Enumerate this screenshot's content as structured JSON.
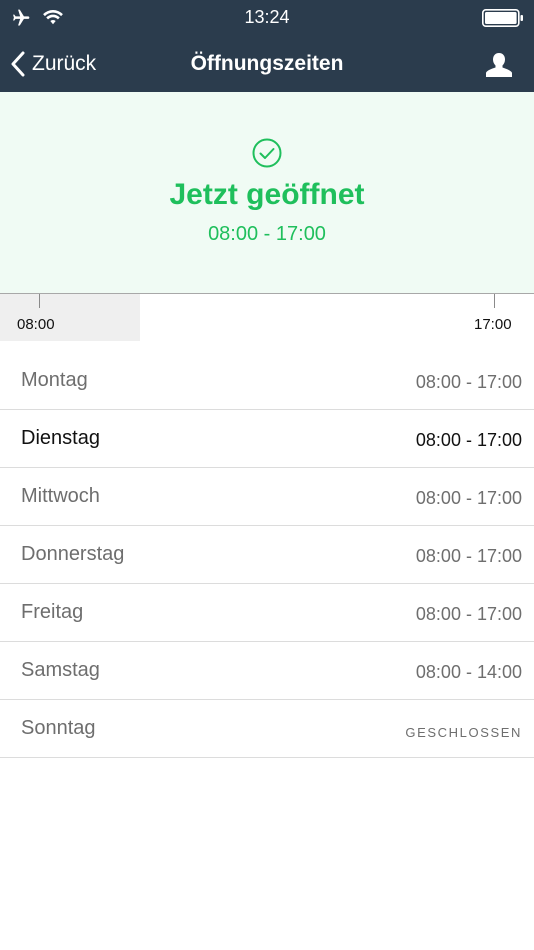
{
  "status_bar": {
    "time": "13:24"
  },
  "nav": {
    "back_label": "Zurück",
    "title": "Öffnungszeiten"
  },
  "banner": {
    "state": "Jetzt geöffnet",
    "hours": "08:00 - 17:00",
    "accent_color": "#1fbf5c"
  },
  "timeline": {
    "start_label": "08:00",
    "end_label": "17:00",
    "elapsed_fraction": 0.23
  },
  "days": [
    {
      "name": "Montag",
      "hours": "08:00 - 17:00"
    },
    {
      "name": "Dienstag",
      "hours": "08:00 - 17:00"
    },
    {
      "name": "Mittwoch",
      "hours": "08:00 - 17:00"
    },
    {
      "name": "Donnerstag",
      "hours": "08:00 - 17:00"
    },
    {
      "name": "Freitag",
      "hours": "08:00 - 17:00"
    },
    {
      "name": "Samstag",
      "hours": "08:00 - 14:00"
    },
    {
      "name": "Sonntag",
      "hours": "GESCHLOSSEN"
    }
  ],
  "colors": {
    "nav_background": "#2b3c4d",
    "banner_background": "#f0fbf4"
  },
  "icons": [
    "airplane-icon",
    "wifi-icon",
    "battery-icon",
    "chevron-left-icon",
    "user-icon",
    "check-circle-icon"
  ]
}
